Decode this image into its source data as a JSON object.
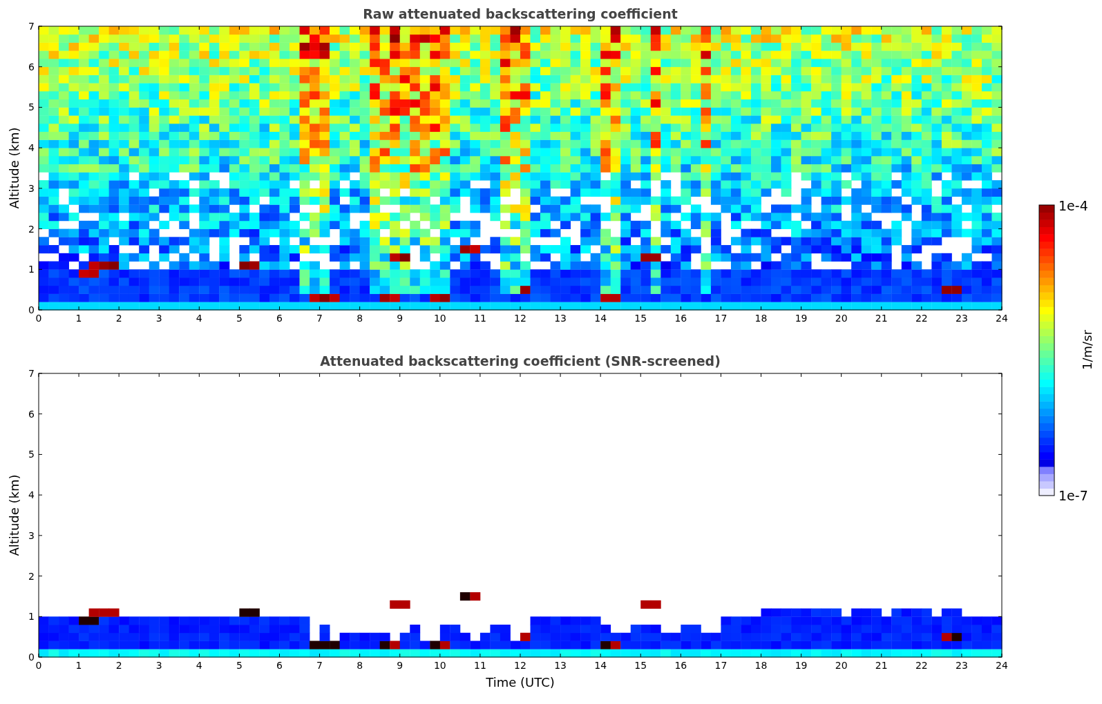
{
  "panels": [
    {
      "kind": "raw",
      "title": "Raw attenuated backscattering coefficient",
      "ylabel": "Altitude (km)",
      "yticks": [
        "7",
        "6",
        "5",
        "4",
        "3",
        "2",
        "1",
        "0"
      ],
      "xticks": [
        "0",
        "1",
        "2",
        "3",
        "4",
        "5",
        "6",
        "7",
        "8",
        "9",
        "10",
        "11",
        "12",
        "13",
        "14",
        "15",
        "16",
        "17",
        "18",
        "19",
        "20",
        "21",
        "22",
        "23",
        "24"
      ]
    },
    {
      "kind": "screened",
      "title": "Attenuated backscattering coefficient (SNR-screened)",
      "ylabel": "Altitude (km)",
      "xlabel": "Time (UTC)",
      "yticks": [
        "7",
        "6",
        "5",
        "4",
        "3",
        "2",
        "1",
        "0"
      ],
      "xticks": [
        "0",
        "1",
        "2",
        "3",
        "4",
        "5",
        "6",
        "7",
        "8",
        "9",
        "10",
        "11",
        "12",
        "13",
        "14",
        "15",
        "16",
        "17",
        "18",
        "19",
        "20",
        "21",
        "22",
        "23",
        "24"
      ]
    }
  ],
  "colorbar": {
    "top_label": "1e-4",
    "bottom_label": "1e-7",
    "label": "1/m/sr"
  }
}
